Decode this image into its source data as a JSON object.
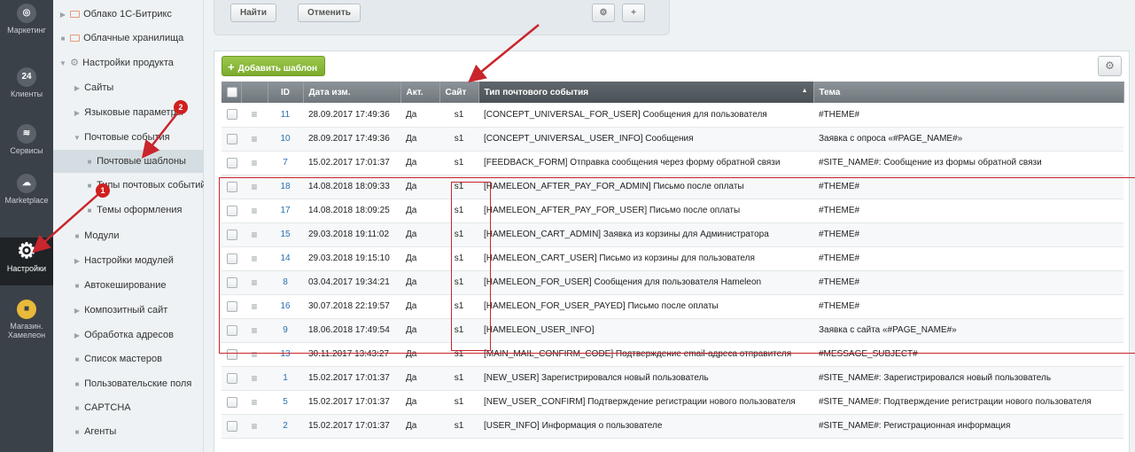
{
  "rail": [
    {
      "label": "Маркетинг",
      "icon": "target-icon"
    },
    {
      "label": "Клиенты",
      "icon": "clients-24-icon",
      "badge": "24"
    },
    {
      "label": "Сервисы",
      "icon": "layers-icon"
    },
    {
      "label": "Marketplace",
      "icon": "cloud-download-icon"
    },
    {
      "label": "Настройки",
      "icon": "gear-icon"
    },
    {
      "label": "Магазин. Хамелеон",
      "icon": "shop-icon"
    }
  ],
  "tree": [
    {
      "label": "Облако 1С-Битрикс",
      "marker": "▶",
      "level": 1
    },
    {
      "label": "Облачные хранилища",
      "marker": "■",
      "level": 1
    },
    {
      "label": "Настройки продукта",
      "marker": "▼",
      "level": 1
    },
    {
      "label": "Сайты",
      "marker": "▶",
      "level": 2
    },
    {
      "label": "Языковые параметры",
      "marker": "▶",
      "level": 2
    },
    {
      "label": "Почтовые события",
      "marker": "▼",
      "level": 2
    },
    {
      "label": "Почтовые шаблоны",
      "marker": "■",
      "level": 3
    },
    {
      "label": "Типы почтовых событий",
      "marker": "■",
      "level": 3
    },
    {
      "label": "Темы оформления",
      "marker": "■",
      "level": 3
    },
    {
      "label": "Модули",
      "marker": "■",
      "level": 2
    },
    {
      "label": "Настройки модулей",
      "marker": "▶",
      "level": 2
    },
    {
      "label": "Автокеширование",
      "marker": "■",
      "level": 2
    },
    {
      "label": "Композитный сайт",
      "marker": "▶",
      "level": 2
    },
    {
      "label": "Обработка адресов",
      "marker": "▶",
      "level": 2
    },
    {
      "label": "Список мастеров",
      "marker": "■",
      "level": 2
    },
    {
      "label": "Пользовательские поля",
      "marker": "■",
      "level": 2
    },
    {
      "label": "CAPTCHA",
      "marker": "■",
      "level": 2
    },
    {
      "label": "Агенты",
      "marker": "■",
      "level": 2
    }
  ],
  "filter": {
    "find": "Найти",
    "cancel": "Отменить",
    "gear": "⚙",
    "plus": "+"
  },
  "toolbar": {
    "add_label": "Добавить шаблон",
    "settings": "⚙"
  },
  "columns": [
    "ID",
    "Дата изм.",
    "Акт.",
    "Сайт",
    "Тип почтового события",
    "Тема"
  ],
  "rows": [
    {
      "id": "11",
      "date": "28.09.2017 17:49:36",
      "act": "Да",
      "site": "s1",
      "type": "[CONCEPT_UNIVERSAL_FOR_USER] Сообщения для пользователя",
      "subject": "#THEME#"
    },
    {
      "id": "10",
      "date": "28.09.2017 17:49:36",
      "act": "Да",
      "site": "s1",
      "type": "[CONCEPT_UNIVERSAL_USER_INFO] Сообщения",
      "subject": "Заявка с опроса «#PAGE_NAME#»"
    },
    {
      "id": "7",
      "date": "15.02.2017 17:01:37",
      "act": "Да",
      "site": "s1",
      "type": "[FEEDBACK_FORM] Отправка сообщения через форму обратной связи",
      "subject": "#SITE_NAME#: Сообщение из формы обратной связи"
    },
    {
      "id": "18",
      "date": "14.08.2018 18:09:33",
      "act": "Да",
      "site": "s1",
      "type": "[HAMELEON_AFTER_PAY_FOR_ADMIN] Письмо после оплаты",
      "subject": "#THEME#"
    },
    {
      "id": "17",
      "date": "14.08.2018 18:09:25",
      "act": "Да",
      "site": "s1",
      "type": "[HAMELEON_AFTER_PAY_FOR_USER] Письмо после оплаты",
      "subject": "#THEME#"
    },
    {
      "id": "15",
      "date": "29.03.2018 19:11:02",
      "act": "Да",
      "site": "s1",
      "type": "[HAMELEON_CART_ADMIN] Заявка из корзины для Администратора",
      "subject": "#THEME#"
    },
    {
      "id": "14",
      "date": "29.03.2018 19:15:10",
      "act": "Да",
      "site": "s1",
      "type": "[HAMELEON_CART_USER] Письмо из корзины для пользователя",
      "subject": "#THEME#"
    },
    {
      "id": "8",
      "date": "03.04.2017 19:34:21",
      "act": "Да",
      "site": "s1",
      "type": "[HAMELEON_FOR_USER] Сообщения для пользователя Hameleon",
      "subject": "#THEME#"
    },
    {
      "id": "16",
      "date": "30.07.2018 22:19:57",
      "act": "Да",
      "site": "s1",
      "type": "[HAMELEON_FOR_USER_PAYED] Письмо после оплаты",
      "subject": "#THEME#"
    },
    {
      "id": "9",
      "date": "18.06.2018 17:49:54",
      "act": "Да",
      "site": "s1",
      "type": "[HAMELEON_USER_INFO]",
      "subject": "Заявка с сайта «#PAGE_NAME#»"
    },
    {
      "id": "13",
      "date": "30.11.2017 13:43:27",
      "act": "Да",
      "site": "s1",
      "type": "[MAIN_MAIL_CONFIRM_CODE] Подтверждение email-адреса отправителя",
      "subject": "#MESSAGE_SUBJECT#"
    },
    {
      "id": "1",
      "date": "15.02.2017 17:01:37",
      "act": "Да",
      "site": "s1",
      "type": "[NEW_USER] Зарегистрировался новый пользователь",
      "subject": "#SITE_NAME#: Зарегистрировался новый пользователь"
    },
    {
      "id": "5",
      "date": "15.02.2017 17:01:37",
      "act": "Да",
      "site": "s1",
      "type": "[NEW_USER_CONFIRM] Подтверждение регистрации нового пользователя",
      "subject": "#SITE_NAME#: Подтверждение регистрации нового пользователя"
    },
    {
      "id": "2",
      "date": "15.02.2017 17:01:37",
      "act": "Да",
      "site": "s1",
      "type": "[USER_INFO] Информация о пользователе",
      "subject": "#SITE_NAME#: Регистрационная информация"
    }
  ],
  "annotations": {
    "badge1": "1",
    "badge2": "2",
    "accent": "#c9252c"
  }
}
